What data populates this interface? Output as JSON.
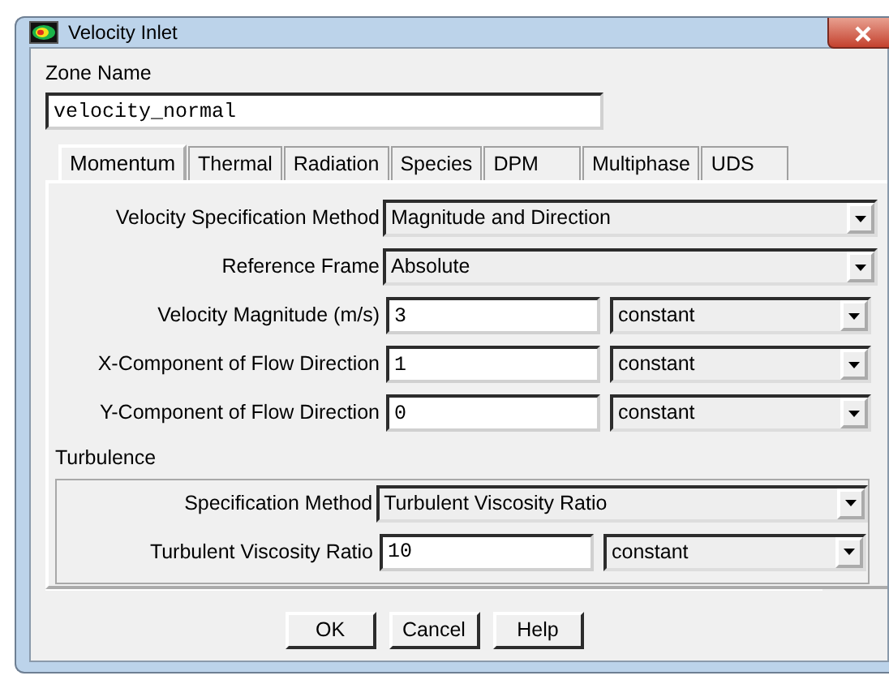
{
  "window": {
    "title": "Velocity Inlet"
  },
  "zone": {
    "label": "Zone Name",
    "value": "velocity_normal"
  },
  "tabs": [
    {
      "label": "Momentum",
      "selected": true
    },
    {
      "label": "Thermal",
      "selected": false
    },
    {
      "label": "Radiation",
      "selected": false
    },
    {
      "label": "Species",
      "selected": false
    },
    {
      "label": "DPM",
      "selected": false
    },
    {
      "label": "Multiphase",
      "selected": false
    },
    {
      "label": "UDS",
      "selected": false
    }
  ],
  "fields": [
    {
      "kind": "dropdown",
      "label": "Velocity Specification Method",
      "value": "Magnitude and Direction"
    },
    {
      "kind": "dropdown",
      "label": "Reference Frame",
      "value": "Absolute"
    },
    {
      "kind": "value",
      "label": "Velocity Magnitude (m/s)",
      "value": "3",
      "profile": "constant"
    },
    {
      "kind": "value",
      "label": "X-Component of Flow Direction",
      "value": "1",
      "profile": "constant"
    },
    {
      "kind": "value",
      "label": "Y-Component of Flow Direction",
      "value": "0",
      "profile": "constant"
    }
  ],
  "turbulence": {
    "title": "Turbulence",
    "fields": [
      {
        "kind": "dropdown",
        "label": "Specification Method",
        "value": "Turbulent Viscosity Ratio"
      },
      {
        "kind": "value",
        "label": "Turbulent Viscosity Ratio",
        "value": "10",
        "profile": "constant"
      }
    ]
  },
  "buttons": [
    "OK",
    "Cancel",
    "Help"
  ]
}
